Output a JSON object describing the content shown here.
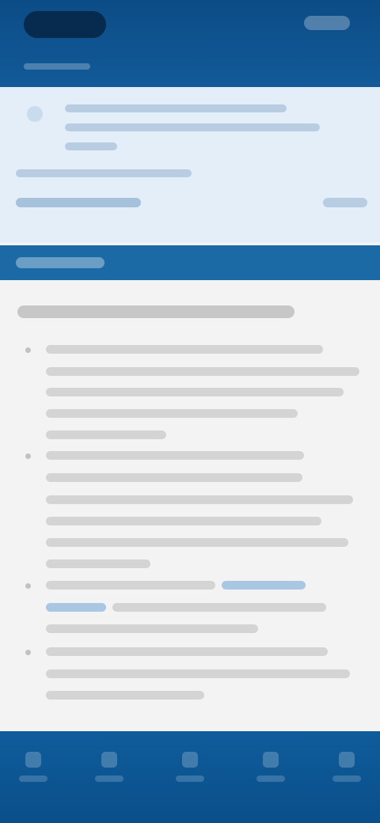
{
  "header": {
    "logo_icon": "logo-icon",
    "action_icon": "account-icon"
  },
  "banner": {
    "icon": "info-icon"
  },
  "bottom_nav": {
    "items": [
      {
        "icon": "home-icon"
      },
      {
        "icon": "search-icon"
      },
      {
        "icon": "inbox-icon"
      },
      {
        "icon": "profile-icon"
      },
      {
        "icon": "menu-icon"
      }
    ]
  },
  "colors": {
    "primary": "#0c4c86",
    "section": "#1b6aa6",
    "banner_bg": "#e3eef8",
    "content_bg": "#f3f3f3"
  }
}
